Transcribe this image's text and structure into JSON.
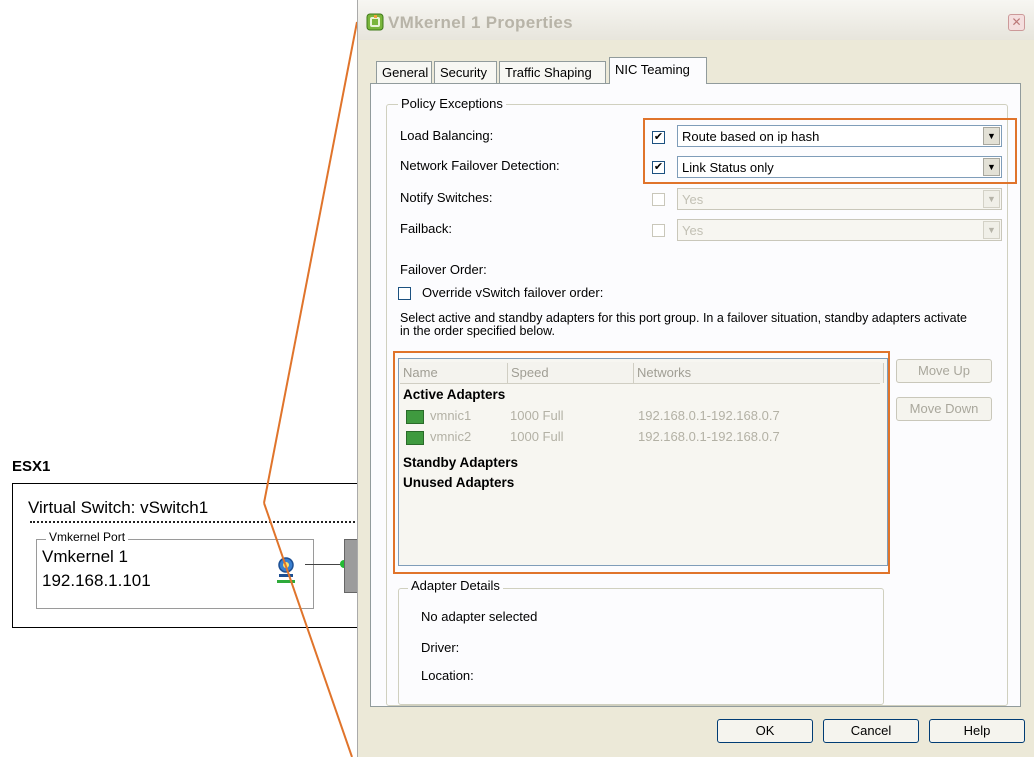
{
  "diagram": {
    "host_label": "ESX1",
    "vswitch_title": "Virtual Switch: vSwitch1",
    "port_group_label": "Vmkernel Port",
    "port_name": "Vmkernel 1",
    "port_ip": "192.168.1.101"
  },
  "dialog": {
    "title": "VMkernel 1 Properties",
    "close_icon": "close-icon",
    "tabs": [
      {
        "label": "General"
      },
      {
        "label": "Security"
      },
      {
        "label": "Traffic Shaping"
      },
      {
        "label": "NIC Teaming",
        "active": true
      }
    ],
    "policy_exceptions": {
      "group_label": "Policy Exceptions",
      "fields": [
        {
          "label": "Load Balancing:",
          "checked": true,
          "value": "Route based on ip hash",
          "enabled": true
        },
        {
          "label": "Network Failover Detection:",
          "checked": true,
          "value": "Link Status only",
          "enabled": true
        },
        {
          "label": "Notify Switches:",
          "checked": false,
          "value": "Yes",
          "enabled": false
        },
        {
          "label": "Failback:",
          "checked": false,
          "value": "Yes",
          "enabled": false
        }
      ],
      "failover_order_label": "Failover Order:",
      "override_label": "Override vSwitch failover order:",
      "override_checked": false,
      "description": "Select active and standby adapters for this port group.  In a failover situation, standby adapters activate  in the order specified below."
    },
    "adapters": {
      "columns": [
        "Name",
        "Speed",
        "Networks"
      ],
      "active_heading": "Active Adapters",
      "active": [
        {
          "name": "vmnic1",
          "speed": "1000 Full",
          "networks": "192.168.0.1-192.168.0.7"
        },
        {
          "name": "vmnic2",
          "speed": "1000 Full",
          "networks": "192.168.0.1-192.168.0.7"
        }
      ],
      "standby_heading": "Standby Adapters",
      "unused_heading": "Unused Adapters",
      "move_up_label": "Move Up",
      "move_down_label": "Move Down"
    },
    "adapter_details": {
      "group_label": "Adapter Details",
      "status": "No adapter selected",
      "driver_label": "Driver:",
      "location_label": "Location:"
    },
    "buttons": {
      "ok": "OK",
      "cancel": "Cancel",
      "help": "Help"
    }
  },
  "colors": {
    "highlight": "#e0742b",
    "dialog_bg": "#ece9d8",
    "nic_icon": "#3f9a3f"
  }
}
